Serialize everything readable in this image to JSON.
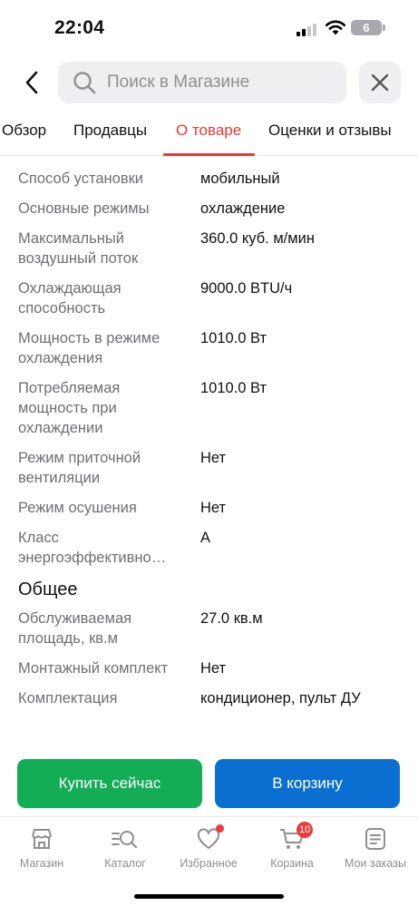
{
  "status_bar": {
    "time": "22:04",
    "battery": "6"
  },
  "search": {
    "placeholder": "Поиск в Магазине",
    "value": ""
  },
  "tabs": [
    {
      "label": "Обзор",
      "active": false
    },
    {
      "label": "Продавцы",
      "active": false
    },
    {
      "label": "О товаре",
      "active": true
    },
    {
      "label": "Оценки и отзывы",
      "active": false
    }
  ],
  "specs": [
    {
      "label": "Способ установки",
      "value": "мобильный"
    },
    {
      "label": "Основные режимы",
      "value": "охлаждение"
    },
    {
      "label": "Максимальный воздушный поток",
      "value": "360.0 куб. м/мин"
    },
    {
      "label": "Охлаждающая способность",
      "value": "9000.0 BTU/ч"
    },
    {
      "label": "Мощность в режиме охлаждения",
      "value": "1010.0 Вт"
    },
    {
      "label": "Потребляемая мощность при охлаждении",
      "value": "1010.0 Вт"
    },
    {
      "label": "Режим приточной вентиляции",
      "value": "Нет"
    },
    {
      "label": "Режим осушения",
      "value": "Нет"
    },
    {
      "label": "Класс энергоэффективно…",
      "value": "A"
    }
  ],
  "general": {
    "title": "Общее",
    "specs": [
      {
        "label": "Обслуживаемая площадь, кв.м",
        "value": "27.0 кв.м"
      },
      {
        "label": "Монтажный комплект",
        "value": "Нет"
      },
      {
        "label": "Комплектация",
        "value": "кондиционер, пульт ДУ"
      }
    ]
  },
  "actions": {
    "buy_now": "Купить сейчас",
    "add_to_cart": "В корзину"
  },
  "bottom_nav": [
    {
      "label": "Магазин",
      "icon": "store-icon"
    },
    {
      "label": "Каталог",
      "icon": "catalog-search-icon"
    },
    {
      "label": "Избранное",
      "icon": "heart-icon"
    },
    {
      "label": "Корзина",
      "icon": "cart-icon",
      "badge": "10"
    },
    {
      "label": "Мои заказы",
      "icon": "orders-icon"
    }
  ],
  "colors": {
    "accent": "#e83a33",
    "buy": "#12ad55",
    "cart": "#0b6fd1",
    "badge": "#ed3b3b"
  }
}
